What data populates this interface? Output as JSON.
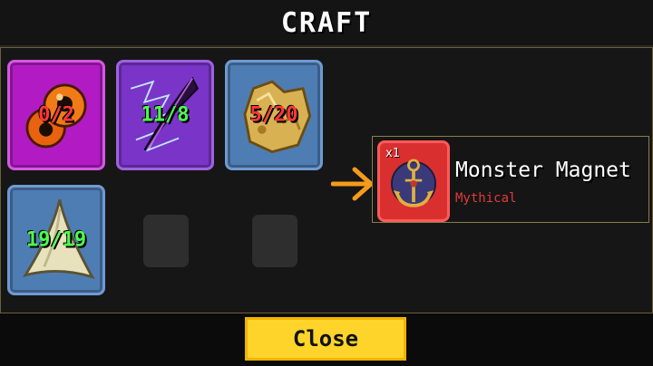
{
  "window": {
    "title": "CRAFT"
  },
  "ingredients": [
    {
      "name": "orange-orbs",
      "count": "0/2",
      "status": "insufficient",
      "rarity_color": "#b21bc4"
    },
    {
      "name": "purple-feather",
      "count": "11/8",
      "status": "sufficient",
      "rarity_color": "#7a34c8"
    },
    {
      "name": "gold-nugget",
      "count": "5/20",
      "status": "insufficient",
      "rarity_color": "#4e7db4"
    },
    {
      "name": "shark-tooth",
      "count": "19/19",
      "status": "sufficient",
      "rarity_color": "#4e7db4"
    }
  ],
  "empty_slots": 2,
  "result": {
    "quantity": "x1",
    "name": "Monster Magnet",
    "rarity": "Mythical",
    "rarity_color": "#e33a3a",
    "icon": "anchor-magnet-icon"
  },
  "buttons": {
    "close_label": "Close"
  },
  "colors": {
    "arrow": "#f59a1b",
    "button": "#ffd42a",
    "panel_border": "#6b5f3b"
  }
}
